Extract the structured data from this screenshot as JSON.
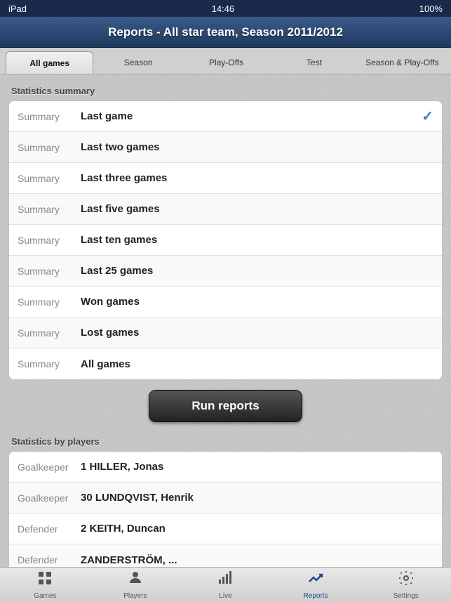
{
  "status_bar": {
    "left": "iPad",
    "time": "14:46",
    "right": "100%"
  },
  "header": {
    "title": "Reports - All star team, Season 2011/2012"
  },
  "top_tabs": [
    {
      "id": "all-games",
      "label": "All games",
      "active": true
    },
    {
      "id": "season",
      "label": "Season",
      "active": false
    },
    {
      "id": "play-offs",
      "label": "Play-Offs",
      "active": false
    },
    {
      "id": "test",
      "label": "Test",
      "active": false
    },
    {
      "id": "season-playoffs",
      "label": "Season & Play-Offs",
      "active": false
    }
  ],
  "statistics_summary": {
    "section_title": "Statistics summary",
    "rows": [
      {
        "label": "Summary",
        "value": "Last game",
        "checked": true
      },
      {
        "label": "Summary",
        "value": "Last two games",
        "checked": false
      },
      {
        "label": "Summary",
        "value": "Last three games",
        "checked": false
      },
      {
        "label": "Summary",
        "value": "Last five games",
        "checked": false
      },
      {
        "label": "Summary",
        "value": "Last ten games",
        "checked": false
      },
      {
        "label": "Summary",
        "value": "Last 25 games",
        "checked": false
      },
      {
        "label": "Summary",
        "value": "Won games",
        "checked": false
      },
      {
        "label": "Summary",
        "value": "Lost games",
        "checked": false
      },
      {
        "label": "Summary",
        "value": "All games",
        "checked": false
      }
    ]
  },
  "run_reports_btn": "Run reports",
  "statistics_players": {
    "section_title": "Statistics by players",
    "rows": [
      {
        "label": "Goalkeeper",
        "value": "1 HILLER, Jonas"
      },
      {
        "label": "Goalkeeper",
        "value": "30 LUNDQVIST, Henrik"
      },
      {
        "label": "Defender",
        "value": "2 KEITH, Duncan"
      },
      {
        "label": "Defender",
        "value": "ZANDERSTRÖM, ..."
      }
    ]
  },
  "bottom_tabs": [
    {
      "id": "games",
      "label": "Games",
      "active": false,
      "icon": "grid"
    },
    {
      "id": "players",
      "label": "Players",
      "active": false,
      "icon": "person"
    },
    {
      "id": "live",
      "label": "Live",
      "active": false,
      "icon": "signal"
    },
    {
      "id": "reports",
      "label": "Reports",
      "active": true,
      "icon": "chart"
    },
    {
      "id": "settings",
      "label": "Settings",
      "active": false,
      "icon": "gear"
    }
  ]
}
